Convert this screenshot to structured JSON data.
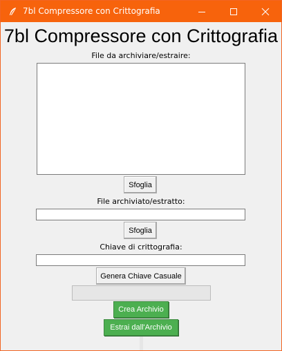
{
  "window": {
    "title": "7bl Compressore con Crittografia",
    "accent_color": "#f7630c",
    "icon": "feather-icon",
    "controls": [
      "minimize-icon",
      "maximize-icon",
      "close-icon"
    ]
  },
  "app": {
    "heading": "7bl Compressore con Crittografia"
  },
  "source": {
    "label": "File da archiviare/estraire:",
    "value": "",
    "browse_label": "Sfoglia"
  },
  "destination": {
    "label": "File archiviato/estratto:",
    "value": "",
    "browse_label": "Sfoglia"
  },
  "key": {
    "label": "Chiave di crittografia:",
    "value": "",
    "generate_label": "Genera Chiave Casuale"
  },
  "progress": {
    "value": 0
  },
  "actions": {
    "create_label": "Crea Archivio",
    "extract_label": "Estrai dall'Archivio",
    "button_color": "#4caf50"
  }
}
